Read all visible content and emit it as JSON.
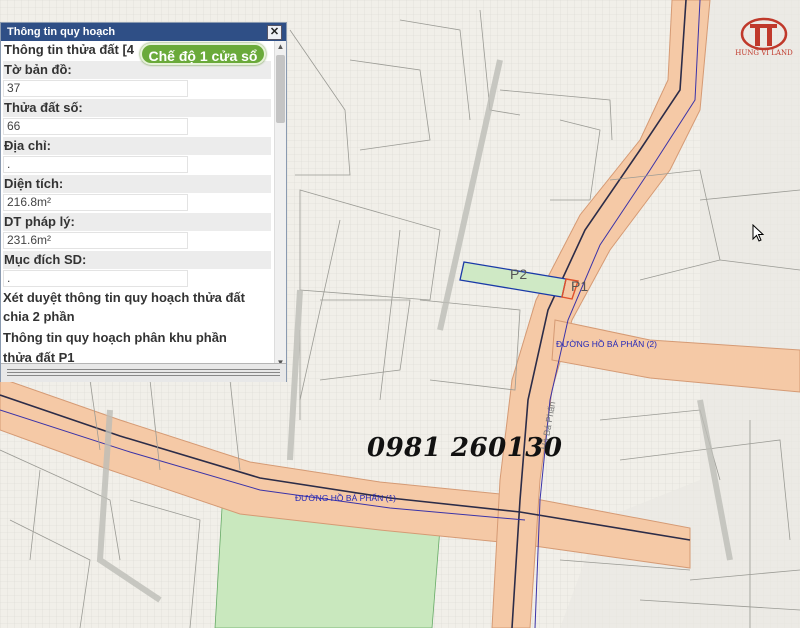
{
  "panel": {
    "title": "Thông tin quy hoạch",
    "close_glyph": "✕",
    "header_line": "Thông tin thửa đất [4",
    "fields": [
      {
        "label": "Tờ bản đồ:",
        "value": "37"
      },
      {
        "label": "Thửa đất số:",
        "value": "66"
      },
      {
        "label": "Địa chỉ:",
        "value": "."
      },
      {
        "label": "Diện tích:",
        "value": "216.8m²"
      },
      {
        "label": "DT pháp lý:",
        "value": "231.6m²"
      },
      {
        "label": "Mục đích SD:",
        "value": "."
      }
    ],
    "approval_line1": "Xét duyệt thông tin quy hoạch thửa đất",
    "approval_line2": "chia 2 phần",
    "zone_line1": "Thông tin quy hoạch phân khu phần",
    "zone_line2": "thửa đất P1"
  },
  "mode_button": "Chế độ 1 cửa sổ",
  "map": {
    "parcel_p1": "P1",
    "parcel_p2": "P2",
    "road_label_1": "ĐƯỜNG HỒ BÁ PHẤN (1)",
    "road_label_2": "ĐƯỜNG HỒ BÁ PHẤN (2)",
    "road_label_vertical": "Hồ Bá Phấn",
    "phone": "0981 260130",
    "colors": {
      "road_fill": "#f5c9a6",
      "green_area": "#c9e8be",
      "parcel_outline": "#1a3aa8",
      "p1_outline": "#e0502a",
      "grid": "#d8d6d0"
    }
  },
  "logo": {
    "brand": "HUNG VI LAND",
    "color": "#c0392b"
  }
}
